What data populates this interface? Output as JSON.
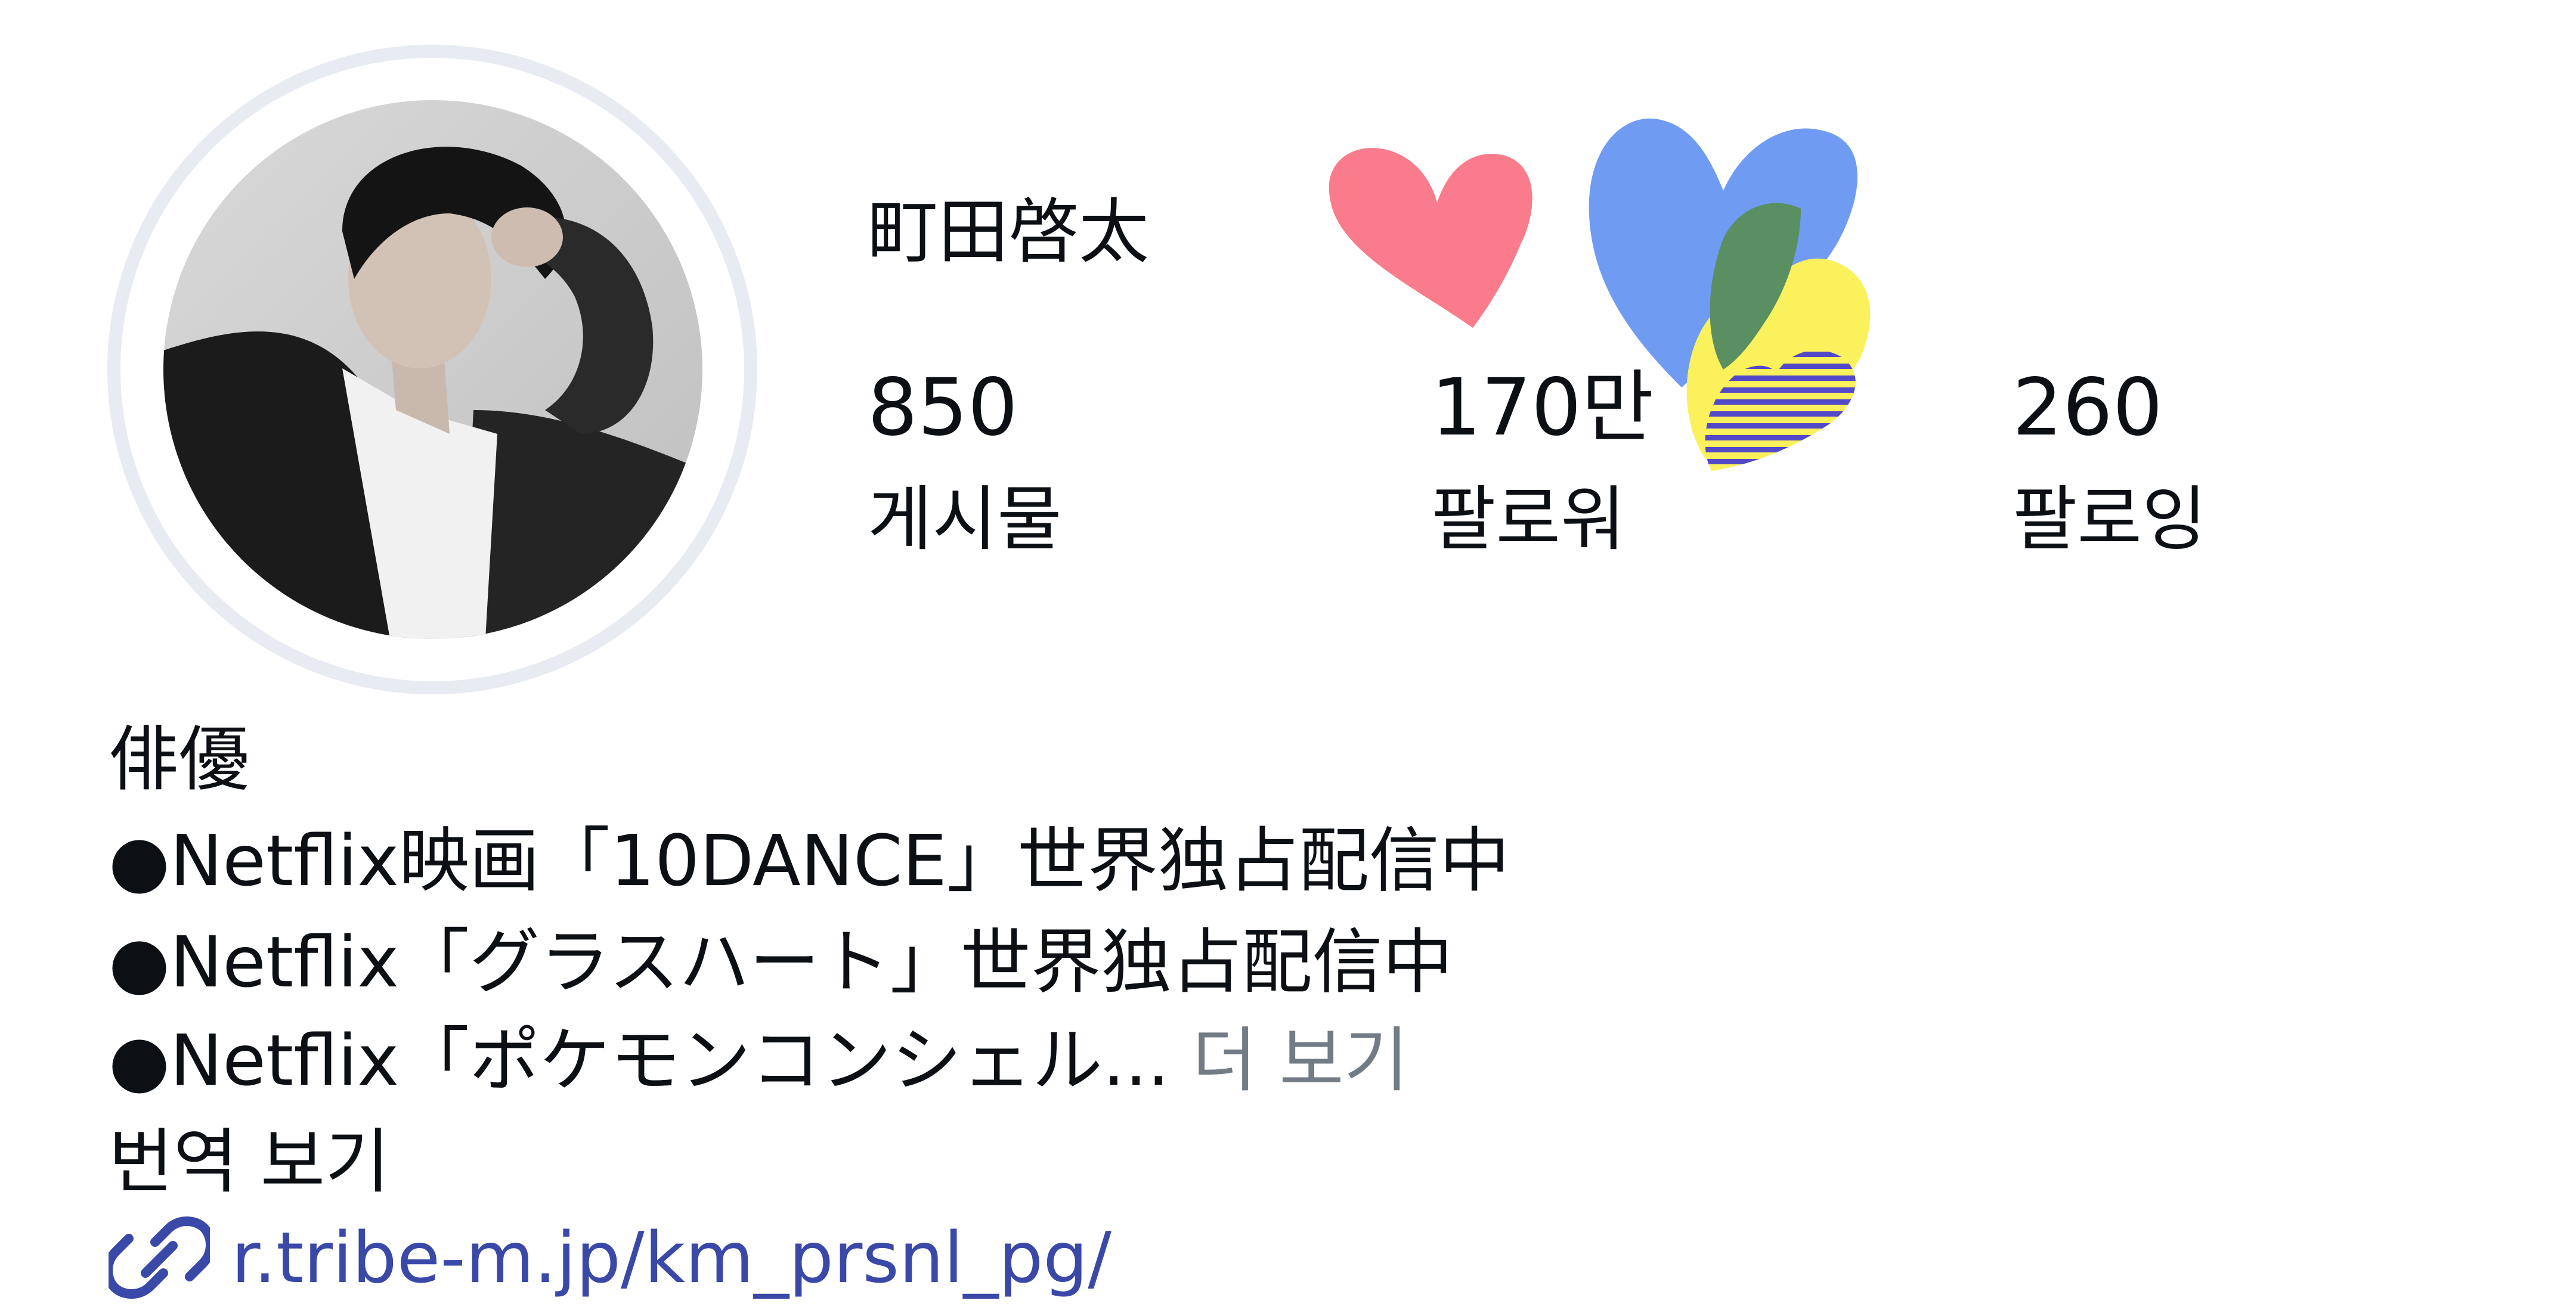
{
  "profile": {
    "username": "町田啓太",
    "avatar": "profile-photo",
    "stats": [
      {
        "value": "850",
        "label": "게시물"
      },
      {
        "value": "170만",
        "label": "팔로워"
      },
      {
        "value": "260",
        "label": "팔로잉"
      }
    ]
  },
  "bio": {
    "lines": [
      "俳優",
      "●Netflix映画「10DANCE」世界独占配信中",
      "●Netflix「グラスハート」世界独占配信中",
      "●Netflix「ポケモンコンシェル..."
    ],
    "more_label": "더 보기",
    "translate_label": "번역 보기",
    "link_text": "r.tribe-m.jp/km_prsnl_pg/",
    "link_icon": "link-icon"
  },
  "colors": {
    "link": "#3a48a8",
    "muted": "#737b85",
    "ring": "#e8ebf1",
    "heart_pink": "#fa7c8c",
    "heart_blue": "#6f9bf2",
    "heart_yellow": "#fbf15c",
    "heart_green": "#5a8f62",
    "heart_stripe": "#5249c8"
  }
}
